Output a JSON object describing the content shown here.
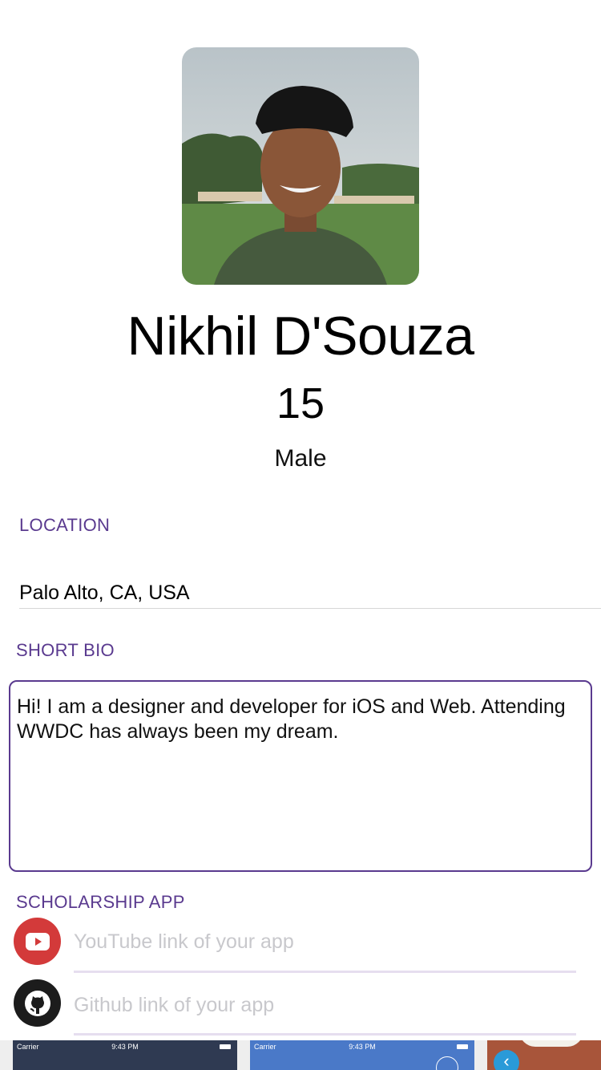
{
  "profile": {
    "name": "Nikhil D'Souza",
    "age": "15",
    "gender": "Male"
  },
  "location": {
    "label": "LOCATION",
    "value": "Palo Alto, CA, USA"
  },
  "bio": {
    "label": "SHORT BIO",
    "text": "Hi! I am a designer and developer for iOS and Web. Attending WWDC has always been my dream."
  },
  "scholarship_app": {
    "label": "SCHOLARSHIP APP",
    "youtube": {
      "icon": "youtube-icon",
      "placeholder": "YouTube link of your app",
      "value": ""
    },
    "github": {
      "icon": "github-icon",
      "placeholder": "Github link of your app",
      "value": ""
    }
  },
  "screenshots": [
    {
      "carrier": "Carrier",
      "time": "9:43 PM"
    },
    {
      "carrier": "Carrier",
      "time": "9:43 PM"
    },
    {
      "carrier": "",
      "time": ""
    }
  ],
  "colors": {
    "accent": "#5a3a8f",
    "youtube": "#d33a3a",
    "github": "#1c1c1c"
  }
}
